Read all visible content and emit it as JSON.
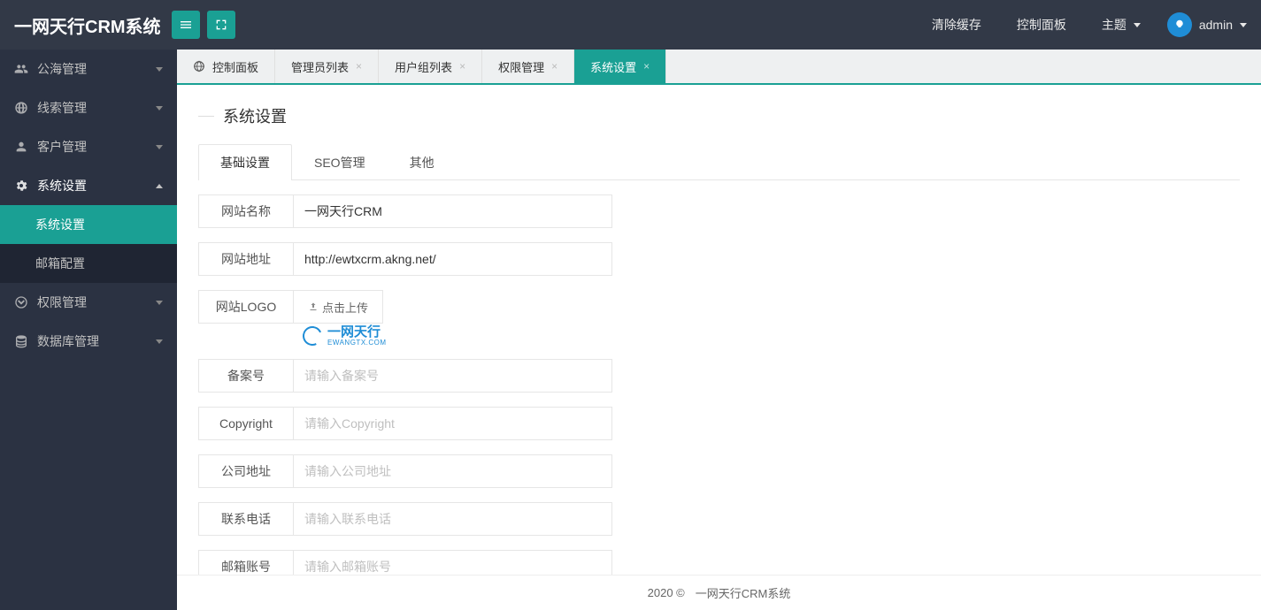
{
  "header": {
    "brand": "一网天行CRM系统",
    "links": {
      "clearCache": "清除缓存",
      "controlPanel": "控制面板",
      "theme": "主题",
      "user": "admin"
    }
  },
  "sidebar": {
    "items": [
      {
        "label": "公海管理",
        "icon": "users",
        "expand": "down"
      },
      {
        "label": "线索管理",
        "icon": "globe",
        "expand": "down"
      },
      {
        "label": "客户管理",
        "icon": "user",
        "expand": "down"
      },
      {
        "label": "系统设置",
        "icon": "gear",
        "expand": "up"
      },
      {
        "label": "权限管理",
        "icon": "shield",
        "expand": "down"
      },
      {
        "label": "数据库管理",
        "icon": "db",
        "expand": "down"
      }
    ],
    "sysSub": [
      {
        "label": "系统设置",
        "active": true
      },
      {
        "label": "邮箱配置",
        "active": false
      }
    ]
  },
  "tabs": [
    {
      "label": "控制面板",
      "closable": false,
      "active": false,
      "icon": true
    },
    {
      "label": "管理员列表",
      "closable": true,
      "active": false
    },
    {
      "label": "用户组列表",
      "closable": true,
      "active": false
    },
    {
      "label": "权限管理",
      "closable": true,
      "active": false
    },
    {
      "label": "系统设置",
      "closable": true,
      "active": true
    }
  ],
  "page": {
    "title": "系统设置",
    "subtabs": [
      "基础设置",
      "SEO管理",
      "其他"
    ],
    "activeSubtab": 0,
    "logoBrand": "一网天行",
    "logoSub": "EWANGTX.COM",
    "fields": {
      "siteName": {
        "label": "网站名称",
        "value": "一网天行CRM",
        "ph": ""
      },
      "siteUrl": {
        "label": "网站地址",
        "value": "http://ewtxcrm.akng.net/",
        "ph": ""
      },
      "siteLogo": {
        "label": "网站LOGO",
        "btn": "点击上传"
      },
      "record": {
        "label": "备案号",
        "value": "",
        "ph": "请输入备案号"
      },
      "copyright": {
        "label": "Copyright",
        "value": "",
        "ph": "请输入Copyright"
      },
      "address": {
        "label": "公司地址",
        "value": "",
        "ph": "请输入公司地址"
      },
      "phone": {
        "label": "联系电话",
        "value": "",
        "ph": "请输入联系电话"
      },
      "email": {
        "label": "邮箱账号",
        "value": "",
        "ph": "请输入邮箱账号"
      }
    }
  },
  "footer": {
    "year": "2020 ©",
    "text": "一网天行CRM系统"
  }
}
